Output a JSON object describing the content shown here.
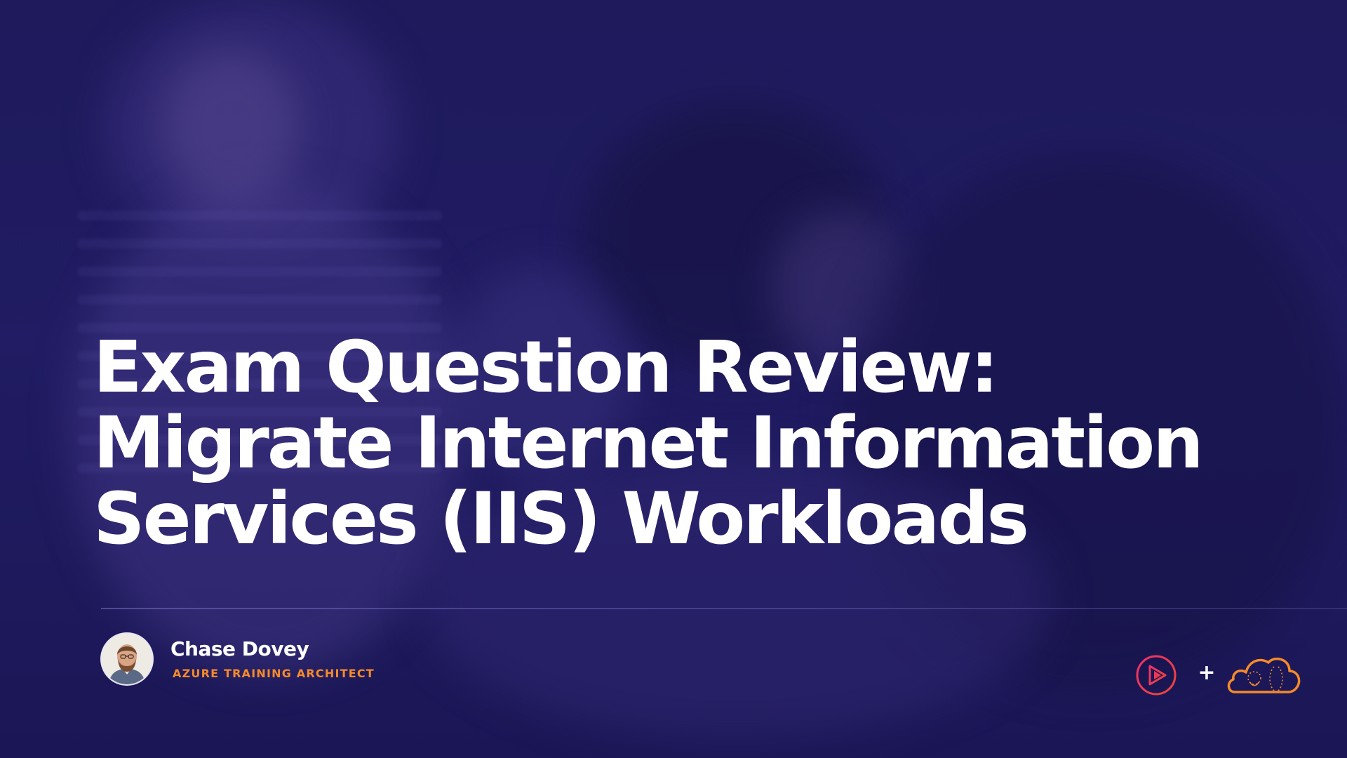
{
  "slide": {
    "title_lines": [
      "Exam Question Review:",
      "Migrate Internet Information",
      "Services (IIS) Workloads"
    ],
    "presenter": {
      "name": "Chase Dovey",
      "role": "AZURE TRAINING ARCHITECT",
      "avatar_icon": "presenter-avatar"
    },
    "logos": {
      "left_icon": "pluralsight-play-icon",
      "separator": "+",
      "right_icon": "cloud-guru-cloud-icon"
    }
  },
  "colors": {
    "background": "#1e1a5c",
    "title": "#ffffff",
    "role_accent": "#f58a2a",
    "pluralsight_gradient": [
      "#f0306a",
      "#e8463a"
    ],
    "cloud_logo": "#f58a2a"
  }
}
